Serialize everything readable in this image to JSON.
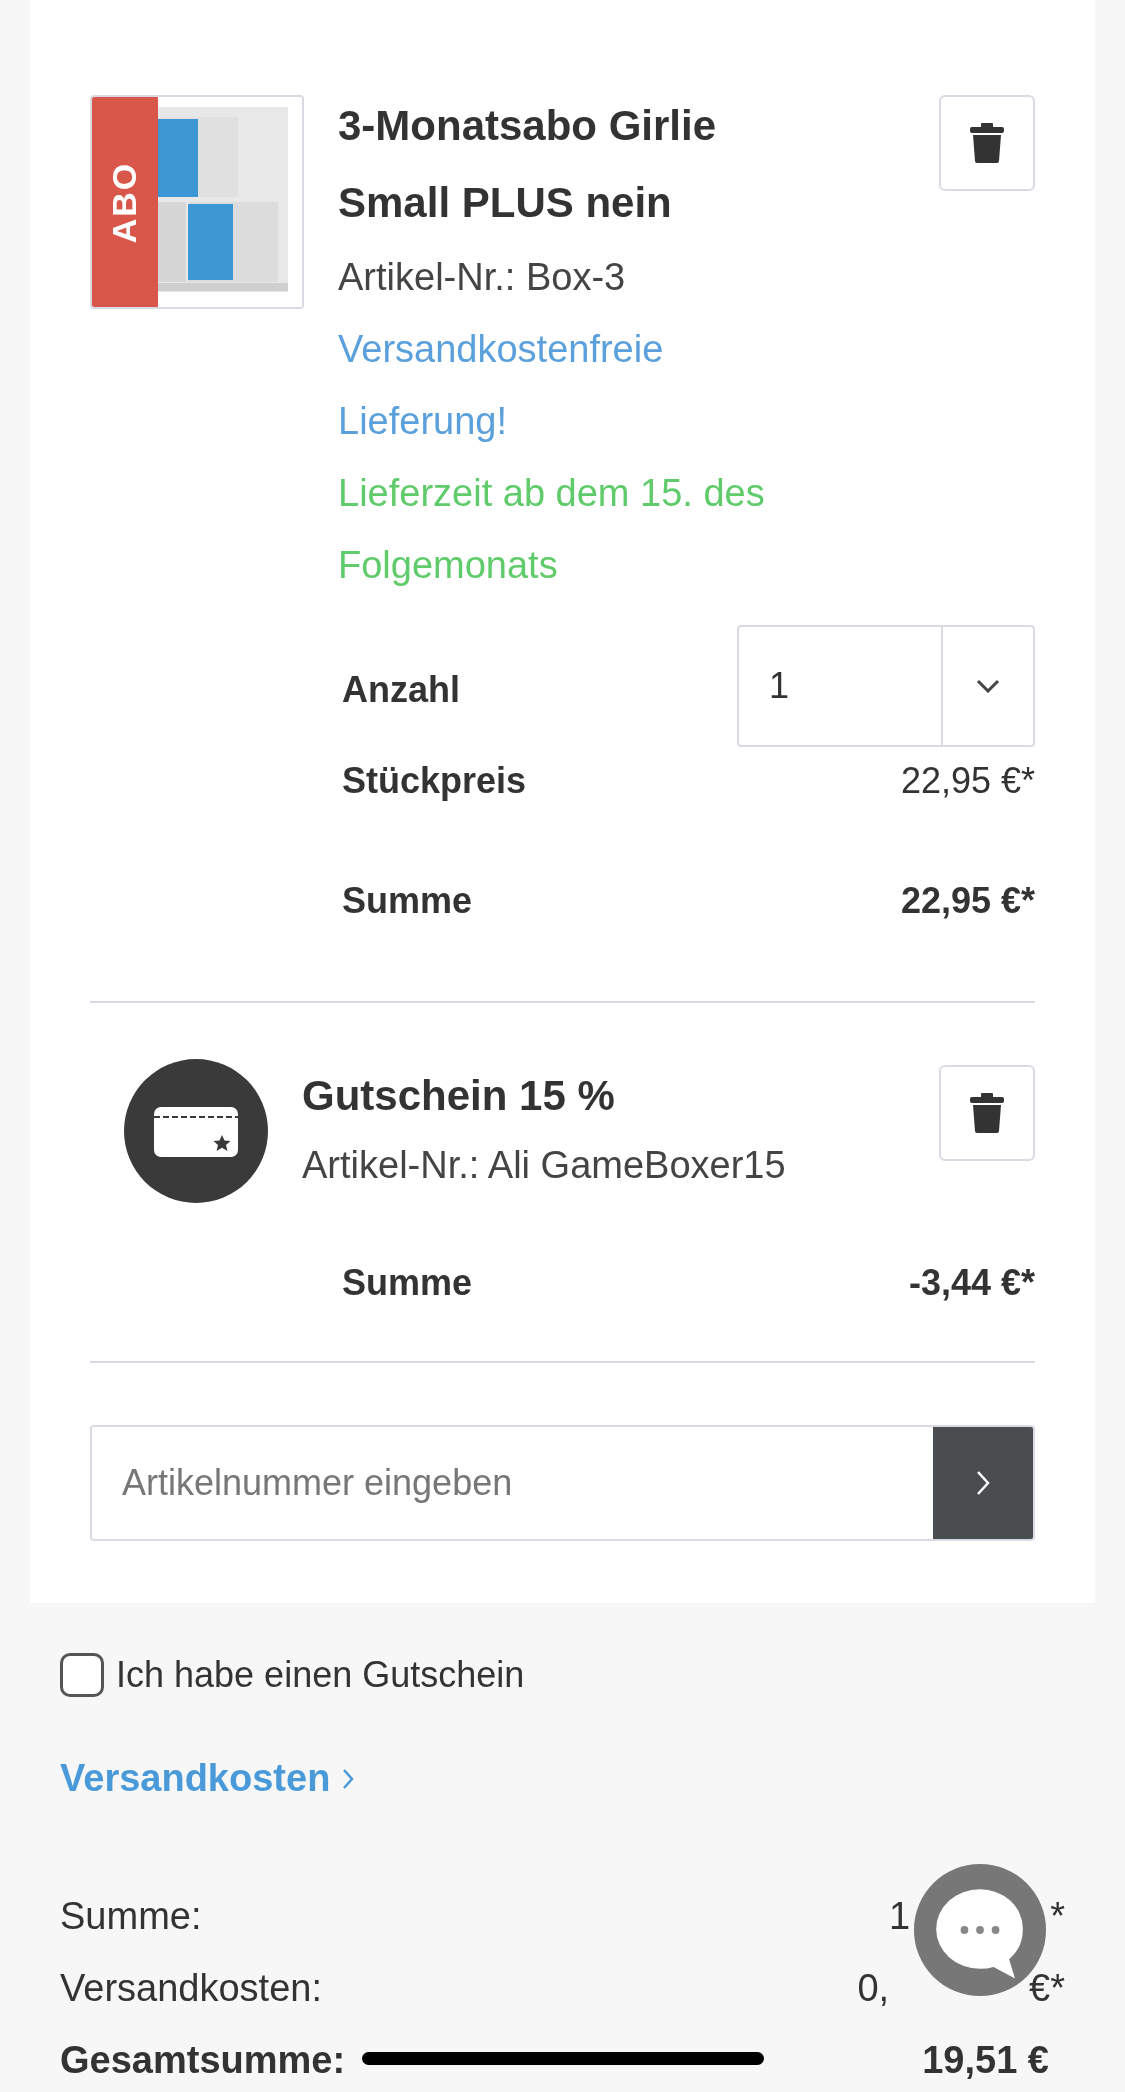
{
  "items": [
    {
      "kind": "product",
      "badge": "ABO",
      "title": "3-Monatsabo Girlie Small PLUS nein",
      "article_number": "Artikel-Nr.: Box-3",
      "shipping_note": "Versandkostenfreie Lieferung!",
      "delivery_note": "Lieferzeit ab dem 15. des Folgemonats",
      "quantity": {
        "label": "Anzahl",
        "value": "1"
      },
      "unit_price": {
        "label": "Stückpreis",
        "value": "22,95 €*"
      },
      "sum": {
        "label": "Summe",
        "value": "22,95 €*"
      }
    },
    {
      "kind": "voucher",
      "title": "Gutschein 15 %",
      "article_number": "Artikel-Nr.: Ali GameBoxer15",
      "sum": {
        "label": "Summe",
        "value": "-3,44 €*"
      }
    }
  ],
  "article_input": {
    "placeholder": "Artikelnummer eingeben"
  },
  "voucher_checkbox": {
    "label": "Ich habe einen Gutschein",
    "checked": false
  },
  "shipping_link": "Versandkosten",
  "totals": [
    {
      "label": "Summe:",
      "value_start": "1",
      "value_end": "*",
      "bold": false
    },
    {
      "label": "Versandkosten:",
      "value_start": "0,",
      "value_end": "€*",
      "bold": false
    },
    {
      "label": "Gesamtsumme:",
      "value_start": "19,51 €",
      "bold": true
    }
  ]
}
